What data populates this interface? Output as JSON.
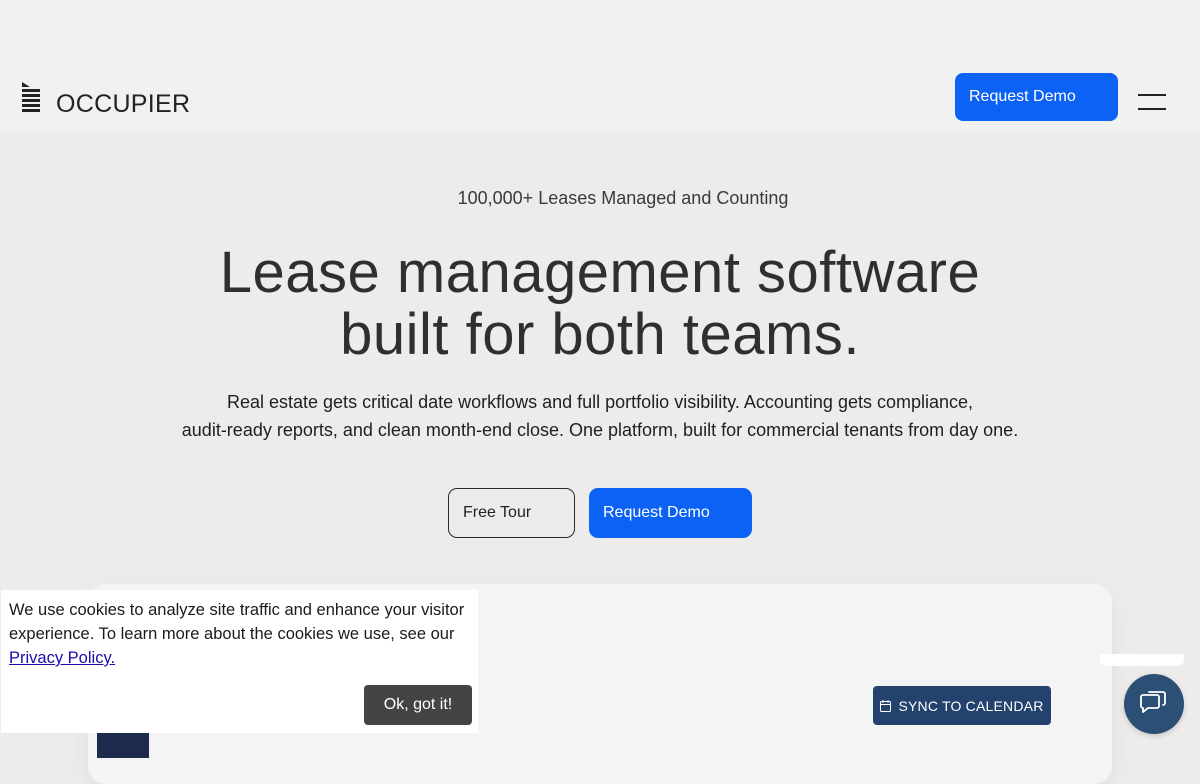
{
  "header": {
    "brand": "OCCUPIER",
    "request_demo_label": "Request Demo",
    "menu_icon": "hamburger-menu-icon",
    "logo_icon": "building-stripes-icon"
  },
  "hero": {
    "eyebrow": "100,000+ Leases Managed and Counting",
    "headline_line1": "Lease management software",
    "headline_line2": "built for both teams.",
    "sub_line1": "Real estate gets critical date workflows and full portfolio visibility. Accounting gets compliance,",
    "sub_line2": "audit-ready reports, and clean month-end close. One platform, built for commercial tenants from day one.",
    "free_tour_label": "Free Tour",
    "request_demo_label": "Request Demo"
  },
  "preview": {
    "sync_label": "SYNC TO CALENDAR",
    "sync_icon": "calendar-icon"
  },
  "cookie": {
    "text": "We use cookies to analyze site traffic and enhance your visitor experience. To learn more about the cookies we use, see our ",
    "link": "Privacy Policy.",
    "ok_label": "Ok, got it!"
  },
  "chat": {
    "icon": "chat-bubble-icon"
  },
  "colors": {
    "primary": "#0c62f5",
    "navy": "#23426d",
    "page_bg": "#edecea",
    "header_bg": "#f1f1f1"
  }
}
